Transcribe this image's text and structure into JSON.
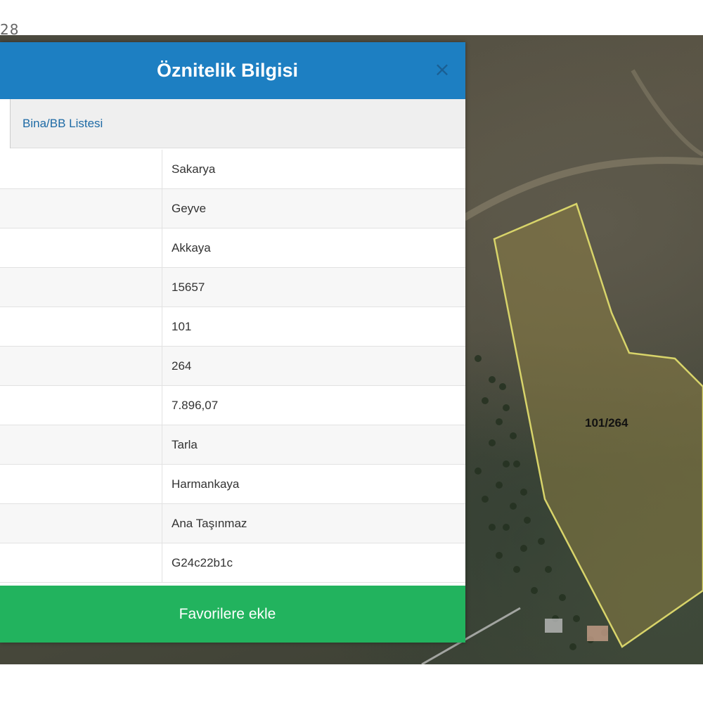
{
  "corner_text": "28",
  "dialog": {
    "title": "Öznitelik Bilgisi",
    "close_icon": "×",
    "tabs": {
      "bina_label": "Bina/BB Listesi"
    },
    "rows": [
      {
        "value": "Sakarya"
      },
      {
        "value": "Geyve"
      },
      {
        "value": "Akkaya"
      },
      {
        "value": "15657"
      },
      {
        "value": "101"
      },
      {
        "value": "264"
      },
      {
        "value": "7.896,07"
      },
      {
        "value": "Tarla"
      },
      {
        "value": "Harmankaya"
      },
      {
        "value": "Ana Taşınmaz"
      },
      {
        "value": "G24c22b1c"
      }
    ],
    "favorite_button": "Favorilere ekle"
  },
  "map": {
    "parcel_label": "101/264",
    "parcel_color": "#d8d46a",
    "header_color": "#1d7fc2",
    "button_color": "#22b35e"
  }
}
